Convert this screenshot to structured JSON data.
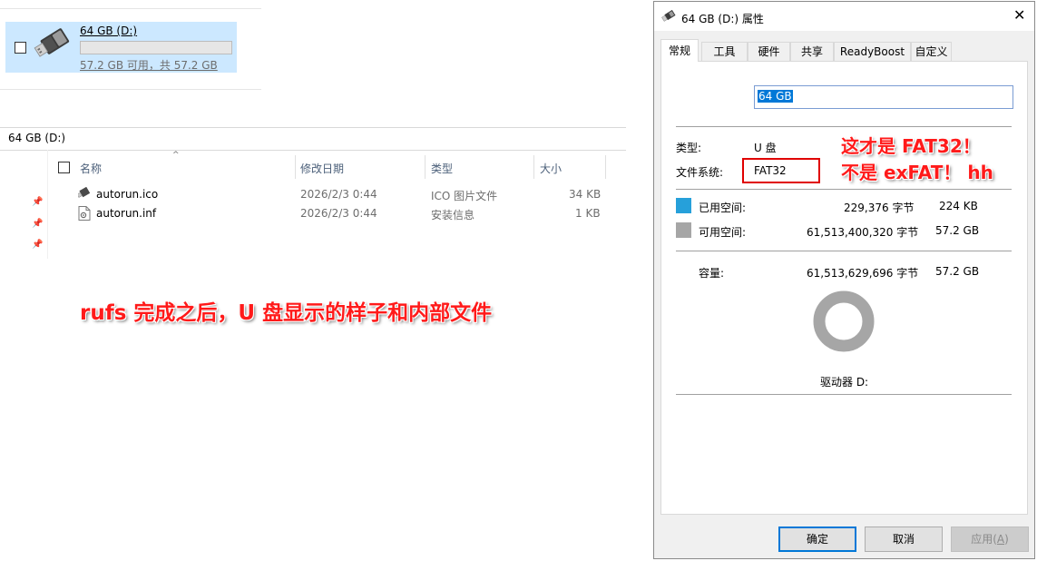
{
  "explorer": {
    "drive_tile": {
      "name": "64 GB (D:)",
      "free_text": "57.2 GB 可用，共 57.2 GB",
      "used_fraction": 0.0
    },
    "address_bar": "64 GB (D:)",
    "columns": {
      "name": "名称",
      "date": "修改日期",
      "type": "类型",
      "size": "大小"
    },
    "files": [
      {
        "name": "autorun.ico",
        "date": "2026/2/3 0:44",
        "type": "ICO 图片文件",
        "size": "34 KB"
      },
      {
        "name": "autorun.inf",
        "date": "2026/2/3 0:44",
        "type": "安装信息",
        "size": "1 KB"
      }
    ],
    "annotation": "rufs 完成之后，U 盘显示的样子和内部文件"
  },
  "dialog": {
    "title": "64 GB (D:) 属性",
    "tabs": [
      "常规",
      "工具",
      "硬件",
      "共享",
      "ReadyBoost",
      "自定义"
    ],
    "tab_hotkeys": [
      "",
      "T",
      "",
      "",
      "",
      ""
    ],
    "volume_label": "64 GB",
    "type_label": "类型:",
    "type_value": "U 盘",
    "fs_label": "文件系统:",
    "fs_value": "FAT32",
    "used_label": "已用空间:",
    "used_bytes": "229,376 字节",
    "used_size": "224 KB",
    "free_label": "可用空间:",
    "free_bytes": "61,513,400,320 字节",
    "free_size": "57.2 GB",
    "capacity_label": "容量:",
    "capacity_bytes": "61,513,629,696 字节",
    "capacity_size": "57.2 GB",
    "drive_label": "驱动器 D:",
    "used_fraction": 3.7e-06,
    "annotation_line1": "这才是 FAT32！",
    "annotation_line2": "不是 exFAT！ hh",
    "buttons": {
      "ok": "确定",
      "cancel": "取消",
      "apply_prefix": "应用(",
      "apply_hotkey": "A",
      "apply_suffix": ")"
    },
    "colors": {
      "used": "#26a0da",
      "free": "#a6a6a6",
      "annotation": "#ff1a1a",
      "highlight_box": "#e00000"
    }
  }
}
